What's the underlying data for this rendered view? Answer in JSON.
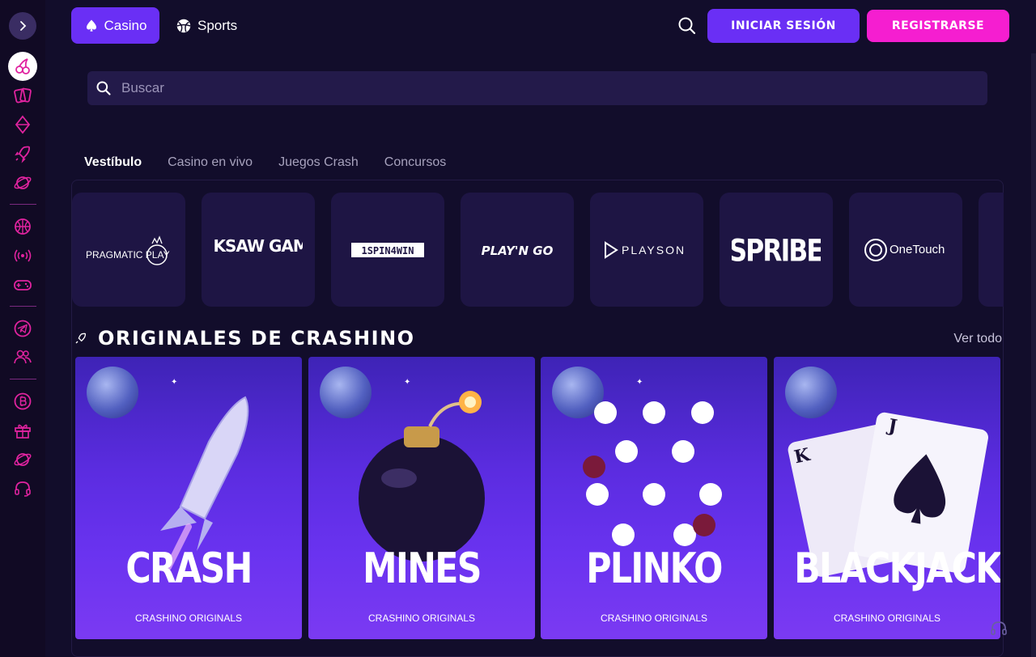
{
  "header": {
    "tab_casino": "Casino",
    "tab_sports": "Sports",
    "login_label": "INICIAR SESIÓN",
    "register_label": "REGISTRARSE"
  },
  "search": {
    "placeholder": "Buscar"
  },
  "subtabs": [
    "Vestíbulo",
    "Casino en vivo",
    "Juegos Crash",
    "Concursos"
  ],
  "providers": [
    "PRAGMATIC PLAY",
    "HACKSAW GAMING",
    "1SPIN4WIN",
    "PLAY'N GO",
    "PLAYSON",
    "SPRIBE",
    "OneTouch"
  ],
  "originals": {
    "title": "ORIGINALES DE CRASHINO",
    "see_all": "Ver todo",
    "games": [
      {
        "title": "CRASH",
        "subtitle": "CRASHINO ORIGINALS"
      },
      {
        "title": "MINES",
        "subtitle": "CRASHINO ORIGINALS"
      },
      {
        "title": "PLINKO",
        "subtitle": "CRASHINO ORIGINALS"
      },
      {
        "title": "BLACKJACK",
        "subtitle": "CRASHINO ORIGINALS"
      }
    ]
  },
  "colors": {
    "accent_purple": "#6a2ff5",
    "accent_pink": "#f51ed0",
    "sidebar_icon": "#e0239f",
    "background": "#120d2b"
  },
  "sidebar_icons": [
    "cherries-icon",
    "cards-icon",
    "diamond-icon",
    "rocket-icon",
    "planet-icon",
    "basketball-icon",
    "live-broadcast-icon",
    "gamepad-icon",
    "telegram-icon",
    "users-icon",
    "bitcoin-icon",
    "gift-icon",
    "planet-icon",
    "headset-icon"
  ]
}
